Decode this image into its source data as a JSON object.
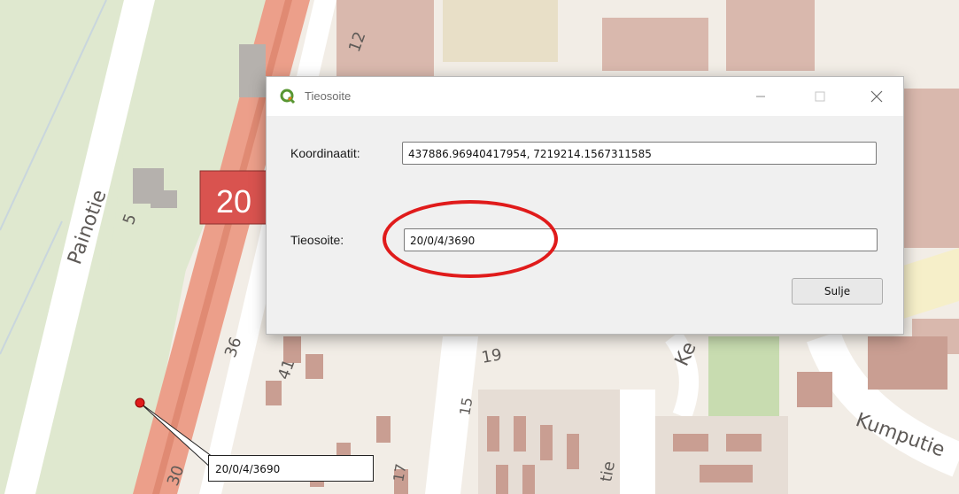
{
  "map": {
    "road_shield": "20",
    "street_painotie": "Painotie",
    "street_kumputie": "Kumputie",
    "street_ke": "Ke",
    "street_tie": "tie",
    "house_numbers": [
      "12",
      "36",
      "41",
      "19",
      "15",
      "17",
      "30",
      "5"
    ],
    "callout_label": "20/0/4/3690",
    "marker_color": "#e01b1b"
  },
  "dialog": {
    "title": "Tieosoite",
    "app_icon": "qgis-logo-icon",
    "window_buttons": {
      "minimize": "—",
      "maximize": "☐",
      "close": "✕"
    },
    "coord_label": "Koordinaatit:",
    "coord_value": "437886.96940417954, 7219214.1567311585",
    "address_label": "Tieosoite:",
    "address_value": "20/0/4/3690",
    "close_button_label": "Sulje",
    "highlight_color": "#e01b1b"
  }
}
